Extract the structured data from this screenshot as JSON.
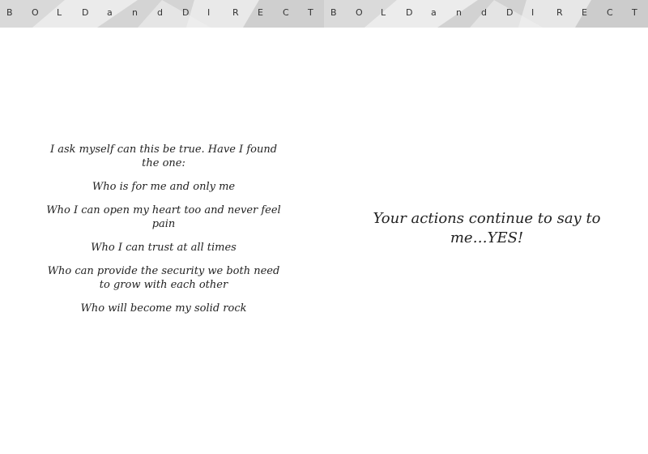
{
  "banner": {
    "left_letters": [
      "B",
      "O",
      "L",
      "D",
      "a",
      "n",
      "d",
      "D",
      "I",
      "R",
      "E",
      "C",
      "T"
    ],
    "right_letters": [
      "B",
      "O",
      "L",
      "D",
      "a",
      "n",
      "d",
      "D",
      "I",
      "R",
      "E",
      "C",
      "T"
    ]
  },
  "left_page": {
    "intro": "I ask myself can this be true.  Have I found the one:",
    "lines": [
      "Who is for me and only me",
      "Who I can open my heart too and never feel pain",
      "Who I can trust at all times",
      "Who can provide the security we both need to grow with each other",
      "Who will become my solid rock"
    ]
  },
  "right_page": {
    "quote": "Your actions continue to say to me…YES!"
  },
  "colors": {
    "banner_bg": "#e6e6e6",
    "banner_shade": "#d0d0d0",
    "text": "#222222"
  }
}
